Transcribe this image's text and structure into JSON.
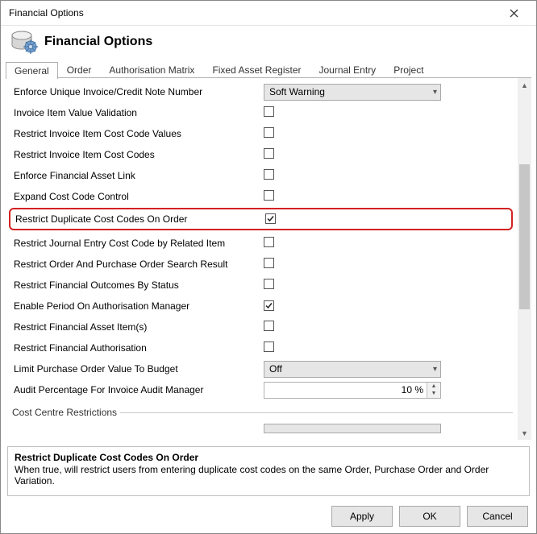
{
  "window": {
    "title": "Financial Options"
  },
  "header": {
    "title": "Financial Options"
  },
  "tabs": {
    "items": [
      {
        "label": "General"
      },
      {
        "label": "Order"
      },
      {
        "label": "Authorisation Matrix"
      },
      {
        "label": "Fixed Asset Register"
      },
      {
        "label": "Journal Entry"
      },
      {
        "label": "Project"
      }
    ],
    "activeIndex": 0
  },
  "rows": [
    {
      "label": "Enforce Unique Invoice/Credit Note Number",
      "type": "combo",
      "value": "Soft Warning"
    },
    {
      "label": "Invoice Item Value Validation",
      "type": "checkbox",
      "checked": false
    },
    {
      "label": "Restrict Invoice Item Cost Code Values",
      "type": "checkbox",
      "checked": false
    },
    {
      "label": "Restrict Invoice Item Cost Codes",
      "type": "checkbox",
      "checked": false
    },
    {
      "label": "Enforce Financial Asset Link",
      "type": "checkbox",
      "checked": false
    },
    {
      "label": "Expand Cost Code Control",
      "type": "checkbox",
      "checked": false
    },
    {
      "label": "Restrict Duplicate Cost Codes On Order",
      "type": "checkbox",
      "checked": true,
      "highlighted": true
    },
    {
      "label": "Restrict Journal Entry Cost Code by Related Item",
      "type": "checkbox",
      "checked": false
    },
    {
      "label": "Restrict Order And Purchase Order Search Result",
      "type": "checkbox",
      "checked": false
    },
    {
      "label": "Restrict Financial Outcomes By Status",
      "type": "checkbox",
      "checked": false
    },
    {
      "label": "Enable Period On Authorisation Manager",
      "type": "checkbox",
      "checked": true
    },
    {
      "label": "Restrict Financial Asset Item(s)",
      "type": "checkbox",
      "checked": false
    },
    {
      "label": "Restrict Financial Authorisation",
      "type": "checkbox",
      "checked": false
    },
    {
      "label": "Limit Purchase Order Value To Budget",
      "type": "combo",
      "value": "Off"
    },
    {
      "label": "Audit Percentage For Invoice Audit Manager",
      "type": "spin",
      "value": "10 %"
    }
  ],
  "group": {
    "label": "Cost Centre Restrictions"
  },
  "description": {
    "title": "Restrict Duplicate Cost Codes On Order",
    "body": "When true, will restrict users from entering duplicate cost codes on the same Order, Purchase Order and Order Variation."
  },
  "footer": {
    "apply": "Apply",
    "ok": "OK",
    "cancel": "Cancel"
  }
}
